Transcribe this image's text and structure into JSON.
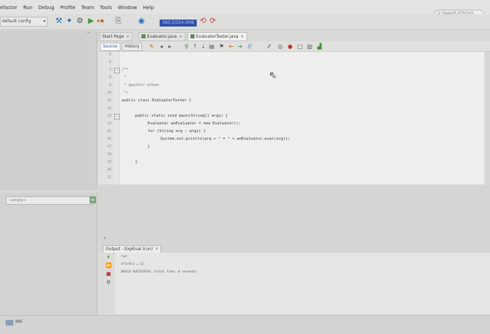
{
  "menubar": {
    "items": [
      "efactor",
      "Run",
      "Debug",
      "Profile",
      "Team",
      "Tools",
      "Window",
      "Help"
    ],
    "search_placeholder": "Search (Ctrl+I)"
  },
  "toolbar": {
    "config": "default config",
    "memory": "383.3/554.0MB"
  },
  "navigator": {
    "filter_placeholder": "<empty>"
  },
  "tabs": [
    {
      "label": "Start Page"
    },
    {
      "label": "Evaluator.java"
    },
    {
      "label": "EvaluatorTester.java"
    }
  ],
  "editor_toolbar": {
    "source": "Source",
    "history": "History"
  },
  "editor": {
    "line_numbers": [
      "5",
      "6",
      "7",
      "8",
      "9",
      "10",
      "11",
      "12",
      "13",
      "14",
      "15",
      "16",
      "17",
      "18",
      "19",
      "20",
      "21"
    ],
    "lines": [
      "/**",
      " *",
      " * @author ethan",
      " */",
      "public class EvaluatorTester {",
      "public static void main(String[] args) {",
      "Evaluator anEvaluator = new Evaluator();",
      "for (String arg : args) {",
      "System.out.println(arg + \" = \" + anEvaluator.eval(arg));",
      "}",
      "}"
    ]
  },
  "output": {
    "tab_label": "Output - ExpEval (run)",
    "lines": [
      "run:",
      "4*2+9/3 = 11",
      "BUILD SUCCESSFUL (total time: 0 seconds)"
    ]
  },
  "statusbar": {
    "mode": "INS"
  }
}
